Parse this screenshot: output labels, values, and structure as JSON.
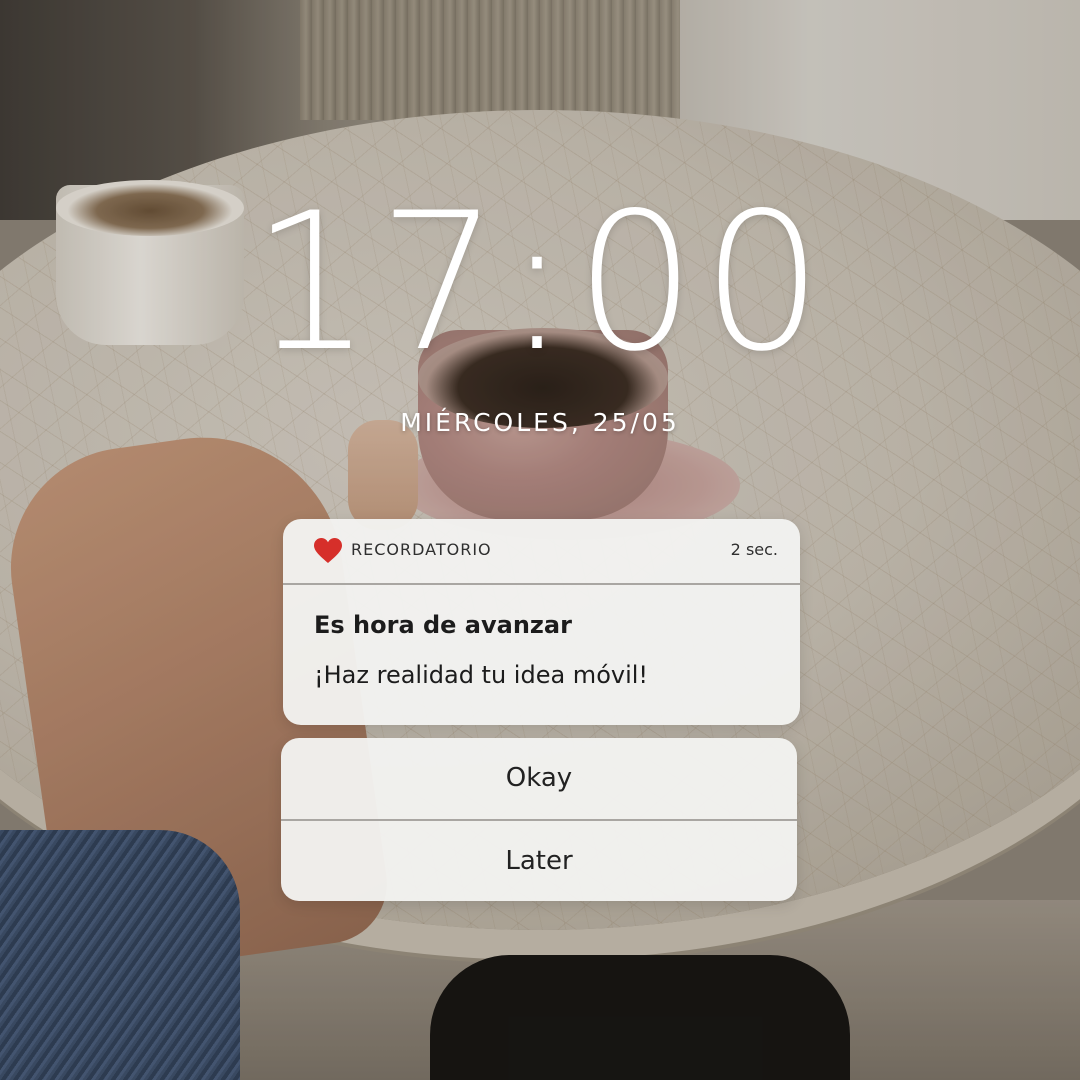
{
  "lock_screen": {
    "time": "17:00",
    "date": "MIÉRCOLES, 25/05"
  },
  "notification": {
    "app_icon": "heart-icon",
    "app_icon_color": "#d62f2a",
    "app_name": "RECORDATORIO",
    "time_ago": "2 sec.",
    "title": "Es hora de avanzar",
    "body": "¡Haz realidad tu idea móvil!"
  },
  "actions": {
    "primary_label": "Okay",
    "secondary_label": "Later"
  }
}
